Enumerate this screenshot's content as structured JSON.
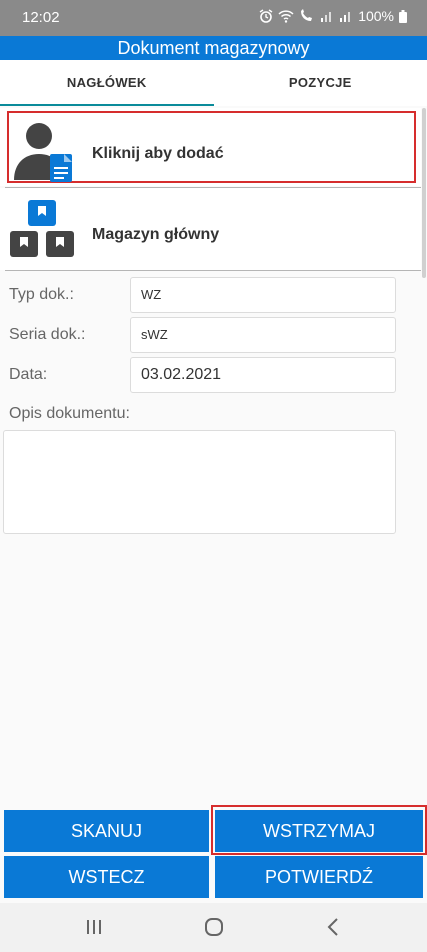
{
  "status_bar": {
    "time": "12:02",
    "battery": "100%"
  },
  "app": {
    "title": "Dokument magazynowy"
  },
  "tabs": [
    {
      "label": "NAGŁÓWEK",
      "active": true
    },
    {
      "label": "POZYCJE",
      "active": false
    }
  ],
  "contractor": {
    "label": "Kliknij aby dodać",
    "icon": "person-document-icon"
  },
  "warehouse": {
    "label": "Magazyn główny",
    "icon": "warehouse-boxes-icon"
  },
  "form": {
    "doc_type": {
      "label": "Typ dok.:",
      "value": "WZ"
    },
    "doc_series": {
      "label": "Seria dok.:",
      "value": "sWZ"
    },
    "date": {
      "label": "Data:",
      "value": "03.02.2021"
    },
    "description": {
      "label": "Opis dokumentu:",
      "value": ""
    }
  },
  "buttons": {
    "scan": "SKANUJ",
    "pause": "WSTRZYMAJ",
    "back": "WSTECZ",
    "confirm": "POTWIERDŹ"
  },
  "colors": {
    "accent": "#0a79d6",
    "highlight": "#d62d2d",
    "status_bar": "#8a8a8a"
  }
}
